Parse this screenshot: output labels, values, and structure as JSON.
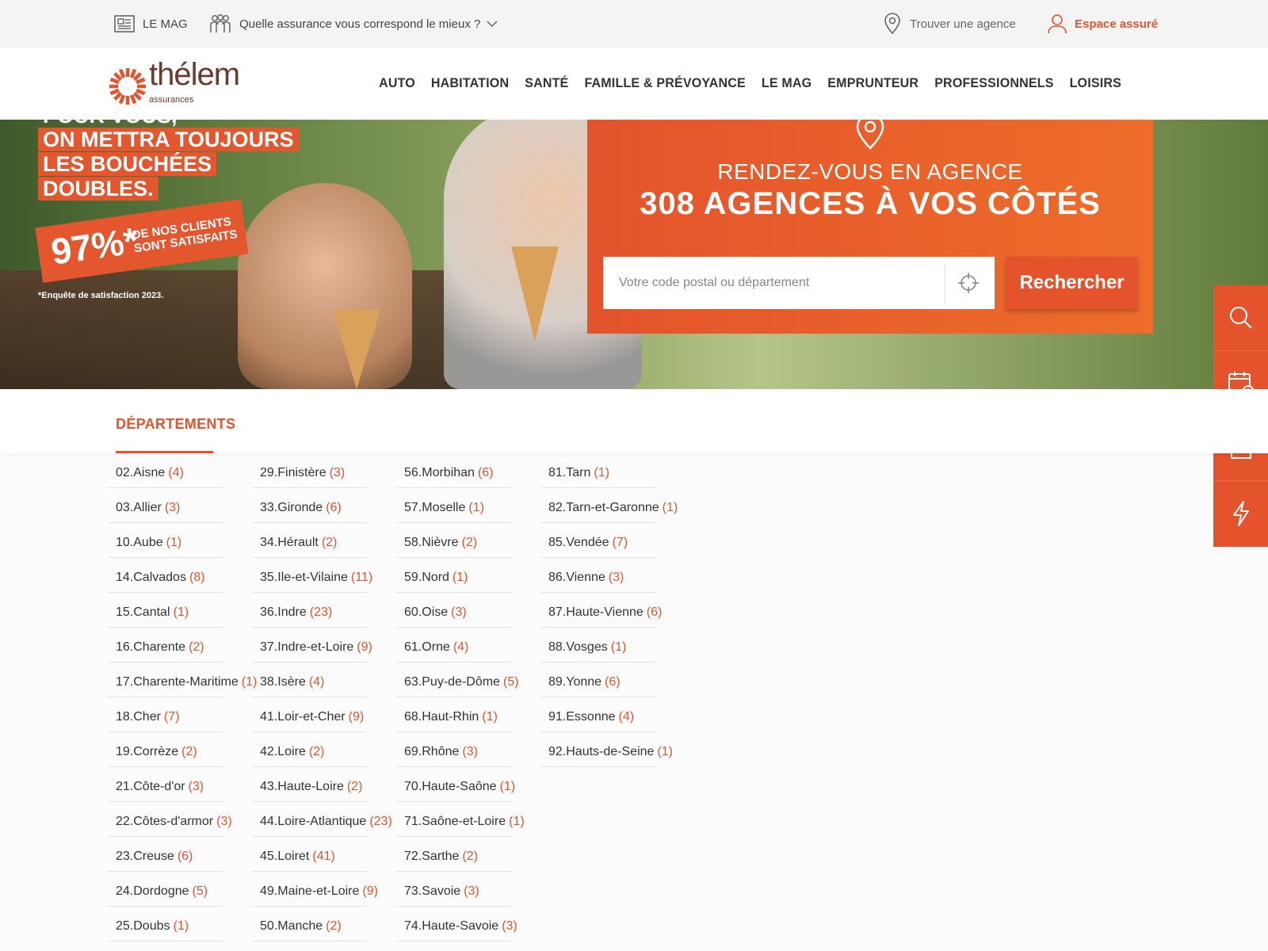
{
  "topbar": {
    "mag_label": "LE MAG",
    "quelle_label": "Quelle assurance vous correspond le mieux ?",
    "agence_label": "Trouver une agence",
    "espace_label": "Espace assuré"
  },
  "logo": {
    "word": "thélem",
    "sub": "assurances"
  },
  "nav": [
    "AUTO",
    "HABITATION",
    "SANTÉ",
    "FAMILLE & PRÉVOYANCE",
    "LE MAG",
    "EMPRUNTEUR",
    "PROFESSIONNELS",
    "LOISIRS"
  ],
  "hero": {
    "slogan_partial": "POUR VOUS,",
    "slogan_lines": [
      "ON METTRA TOUJOURS",
      "LES BOUCHÉES",
      "DOUBLES."
    ],
    "badge_pct": "97%*",
    "badge_text": "DE NOS CLIENTS SONT SATISFAITS",
    "disclaimer": "*Enquête de satisfaction 2023.",
    "kicker": "RENDEZ-VOUS EN AGENCE",
    "title": "308 AGENCES À VOS CÔTÉS",
    "search_placeholder": "Votre code postal ou département",
    "search_button": "Rechercher"
  },
  "sidebar": [
    "search-icon",
    "calendar-icon",
    "edit-icon",
    "lightning-icon"
  ],
  "departements": {
    "tab_label": "DÉPARTEMENTS",
    "columns": [
      [
        {
          "name": "02.Aisne",
          "count": "(4)"
        },
        {
          "name": "03.Allier",
          "count": "(3)"
        },
        {
          "name": "10.Aube",
          "count": "(1)"
        },
        {
          "name": "14.Calvados",
          "count": "(8)"
        },
        {
          "name": "15.Cantal",
          "count": "(1)"
        },
        {
          "name": "16.Charente",
          "count": "(2)"
        },
        {
          "name": "17.Charente-Maritime",
          "count": "(1)"
        },
        {
          "name": "18.Cher",
          "count": "(7)"
        },
        {
          "name": "19.Corrèze",
          "count": "(2)"
        },
        {
          "name": "21.Côte-d'or",
          "count": "(3)"
        },
        {
          "name": "22.Côtes-d'armor",
          "count": "(3)"
        },
        {
          "name": "23.Creuse",
          "count": "(6)"
        },
        {
          "name": "24.Dordogne",
          "count": "(5)"
        },
        {
          "name": "25.Doubs",
          "count": "(1)"
        }
      ],
      [
        {
          "name": "29.Finistère",
          "count": "(3)"
        },
        {
          "name": "33.Gironde",
          "count": "(6)"
        },
        {
          "name": "34.Hérault",
          "count": "(2)"
        },
        {
          "name": "35.Ile-et-Vilaine",
          "count": "(11)"
        },
        {
          "name": "36.Indre",
          "count": "(23)"
        },
        {
          "name": "37.Indre-et-Loire",
          "count": "(9)"
        },
        {
          "name": "38.Isère",
          "count": "(4)"
        },
        {
          "name": "41.Loir-et-Cher",
          "count": "(9)"
        },
        {
          "name": "42.Loire",
          "count": "(2)"
        },
        {
          "name": "43.Haute-Loire",
          "count": "(2)"
        },
        {
          "name": "44.Loire-Atlantique",
          "count": "(23)"
        },
        {
          "name": "45.Loiret",
          "count": "(41)"
        },
        {
          "name": "49.Maine-et-Loire",
          "count": "(9)"
        },
        {
          "name": "50.Manche",
          "count": "(2)"
        }
      ],
      [
        {
          "name": "56.Morbihan",
          "count": "(6)"
        },
        {
          "name": "57.Moselle",
          "count": "(1)"
        },
        {
          "name": "58.Nièvre",
          "count": "(2)"
        },
        {
          "name": "59.Nord",
          "count": "(1)"
        },
        {
          "name": "60.Oise",
          "count": "(3)"
        },
        {
          "name": "61.Orne",
          "count": "(4)"
        },
        {
          "name": "63.Puy-de-Dôme",
          "count": "(5)"
        },
        {
          "name": "68.Haut-Rhin",
          "count": "(1)"
        },
        {
          "name": "69.Rhône",
          "count": "(3)"
        },
        {
          "name": "70.Haute-Saône",
          "count": "(1)"
        },
        {
          "name": "71.Saône-et-Loire",
          "count": "(1)"
        },
        {
          "name": "72.Sarthe",
          "count": "(2)"
        },
        {
          "name": "73.Savoie",
          "count": "(3)"
        },
        {
          "name": "74.Haute-Savoie",
          "count": "(3)"
        }
      ],
      [
        {
          "name": "81.Tarn",
          "count": "(1)"
        },
        {
          "name": "82.Tarn-et-Garonne",
          "count": "(1)"
        },
        {
          "name": "85.Vendée",
          "count": "(7)"
        },
        {
          "name": "86.Vienne",
          "count": "(3)"
        },
        {
          "name": "87.Haute-Vienne",
          "count": "(6)"
        },
        {
          "name": "88.Vosges",
          "count": "(1)"
        },
        {
          "name": "89.Yonne",
          "count": "(6)"
        },
        {
          "name": "91.Essonne",
          "count": "(4)"
        },
        {
          "name": "92.Hauts-de-Seine",
          "count": "(1)"
        }
      ]
    ]
  },
  "colors": {
    "brand": "#e4532c",
    "logo_brown": "#6b3a2a"
  }
}
